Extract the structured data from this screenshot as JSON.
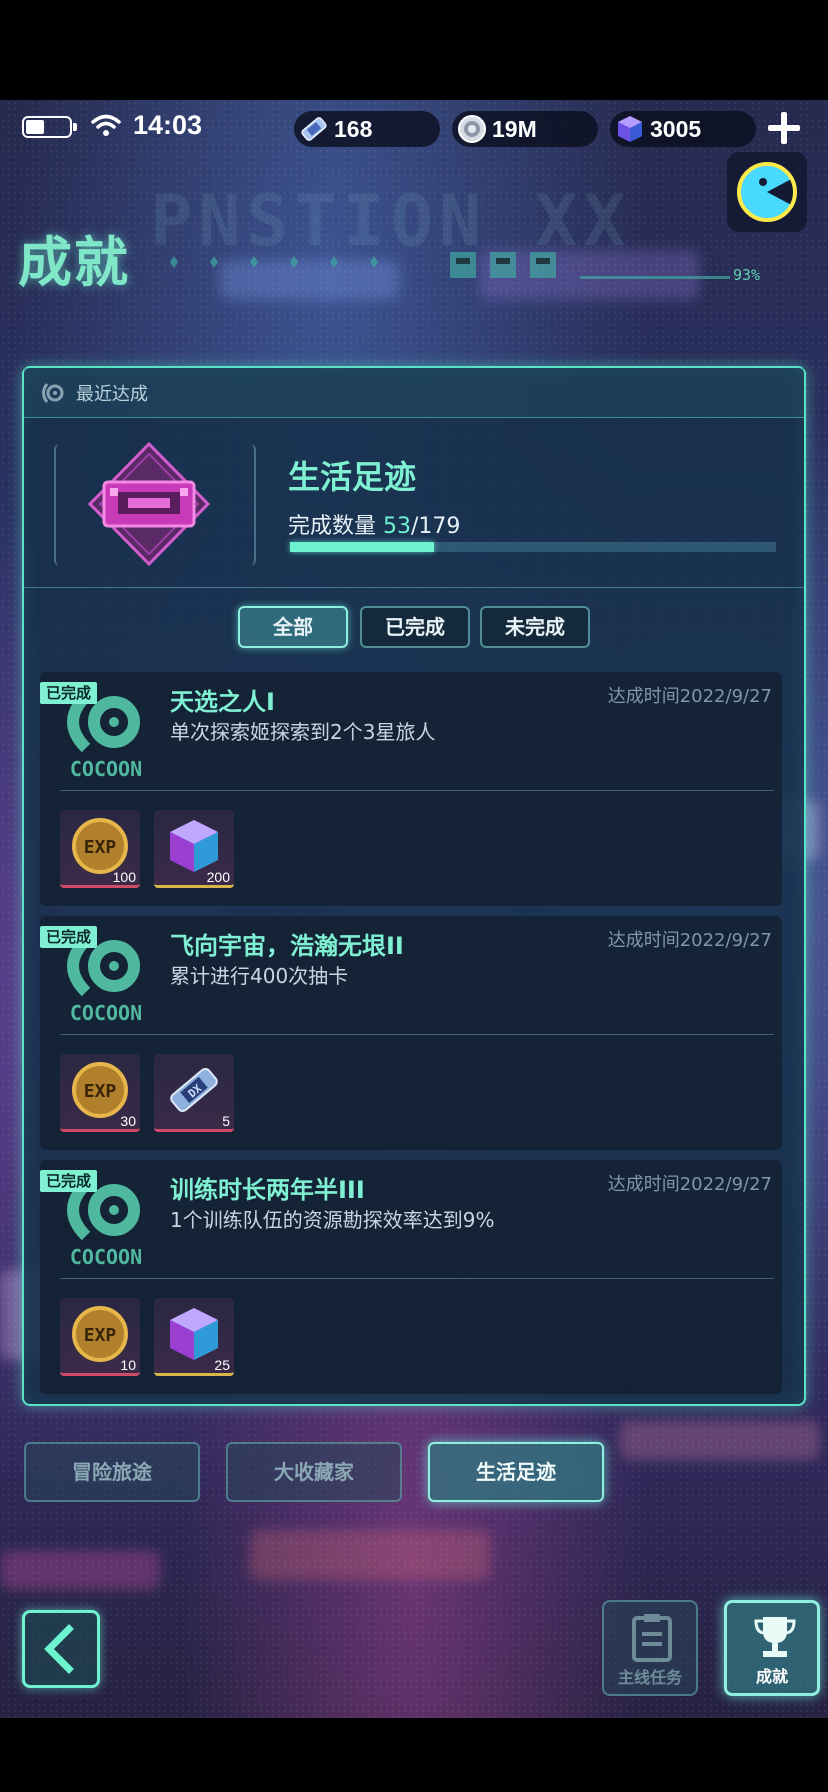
{
  "status_bar": {
    "time": "14:03",
    "currencies": [
      {
        "icon": "ticket-icon",
        "value": "168"
      },
      {
        "icon": "gear-coin-icon",
        "value": "19M"
      },
      {
        "icon": "cube-gem-icon",
        "value": "3005"
      }
    ]
  },
  "banner": {
    "title": "成就",
    "ghost_text": "PNSTION XX",
    "percent": "93%"
  },
  "panel": {
    "header_label": "最近达成",
    "recent": {
      "title": "生活足迹",
      "progress_label": "完成数量",
      "progress_current": "53",
      "progress_total": "/179",
      "progress_fraction": 0.296
    },
    "filters": [
      {
        "label": "全部",
        "active": true
      },
      {
        "label": "已完成",
        "active": false
      },
      {
        "label": "未完成",
        "active": false
      }
    ],
    "achievements": [
      {
        "badge": "已完成",
        "title": "天选之人I",
        "desc": "单次探索姬探索到2个3星旅人",
        "time": "达成时间2022/9/27",
        "rewards": [
          {
            "icon": "exp-coin-icon",
            "count": "100"
          },
          {
            "icon": "cube-gem-icon",
            "count": "200"
          }
        ]
      },
      {
        "badge": "已完成",
        "title": "飞向宇宙，浩瀚无垠II",
        "desc": "累计进行400次抽卡",
        "time": "达成时间2022/9/27",
        "rewards": [
          {
            "icon": "exp-coin-icon",
            "count": "30"
          },
          {
            "icon": "ticket-icon",
            "count": "5"
          }
        ]
      },
      {
        "badge": "已完成",
        "title": "训练时长两年半III",
        "desc": "1个训练队伍的资源勘探效率达到9%",
        "time": "达成时间2022/9/27",
        "rewards": [
          {
            "icon": "exp-coin-icon",
            "count": "10"
          },
          {
            "icon": "cube-gem-icon",
            "count": "25"
          }
        ]
      }
    ]
  },
  "categories": [
    {
      "label": "冒险旅途",
      "active": false
    },
    {
      "label": "大收藏家",
      "active": false
    },
    {
      "label": "生活足迹",
      "active": true
    }
  ],
  "bottom_nav": {
    "main_quest_label": "主线任务",
    "achievement_label": "成就"
  },
  "colors": {
    "accent": "#6ef3d0",
    "panel_border": "#5be3c7",
    "badge_bg": "#7ff0d2"
  }
}
